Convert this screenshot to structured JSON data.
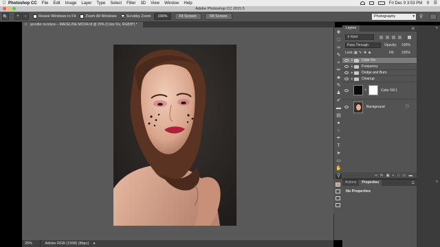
{
  "menubar": {
    "app_name": "Photoshop CC",
    "items": [
      "File",
      "Edit",
      "Image",
      "Layer",
      "Type",
      "Select",
      "Filter",
      "3D",
      "View",
      "Window",
      "Help"
    ],
    "clock": "Fri Dec 9  3:53 PM"
  },
  "app_title": "Adobe Photoshop CC 2015.5",
  "options": {
    "resize_windows": "Resize Windows to Fit",
    "zoom_all": "Zoom All Windows",
    "scrubby": "Scrubby Zoom",
    "zoom_value": "100%",
    "fit_screen_1": "Fit Screen",
    "fit_screen_2": "Fill Screen",
    "workspace": "Photography"
  },
  "document": {
    "owner": "jennifer mcintyre",
    "tab_title": "MADELINE M3194.tif @ 25% (Color Fix, RGB/8*) *"
  },
  "status": {
    "zoom": "25%",
    "doc_info": "Adobe RGB (1998) (8bpc)"
  },
  "layers_panel": {
    "title": "Layers",
    "filter_kind": "Kind",
    "blend_mode": "Pass Through",
    "opacity_label": "Opacity:",
    "opacity_value": "100%",
    "lock_label": "Lock:",
    "fill_label": "Fill:",
    "fill_value": "100%",
    "layers": [
      {
        "name": "Color Fix",
        "type": "group",
        "selected": true
      },
      {
        "name": "Frequency",
        "type": "group"
      },
      {
        "name": "Dodge and Burn",
        "type": "group"
      },
      {
        "name": "Cleanup",
        "type": "group"
      },
      {
        "name": "Color Fill 1",
        "type": "fill"
      },
      {
        "name": "Background",
        "type": "image"
      }
    ]
  },
  "properties_panel": {
    "tabs": [
      "Actions",
      "Properties"
    ],
    "content": "No Properties"
  },
  "colors": {
    "menubar": "#ececec",
    "panel": "#535353",
    "canvas": "#595959",
    "selection": "#7c7c7c",
    "backdrop": "#262221"
  }
}
